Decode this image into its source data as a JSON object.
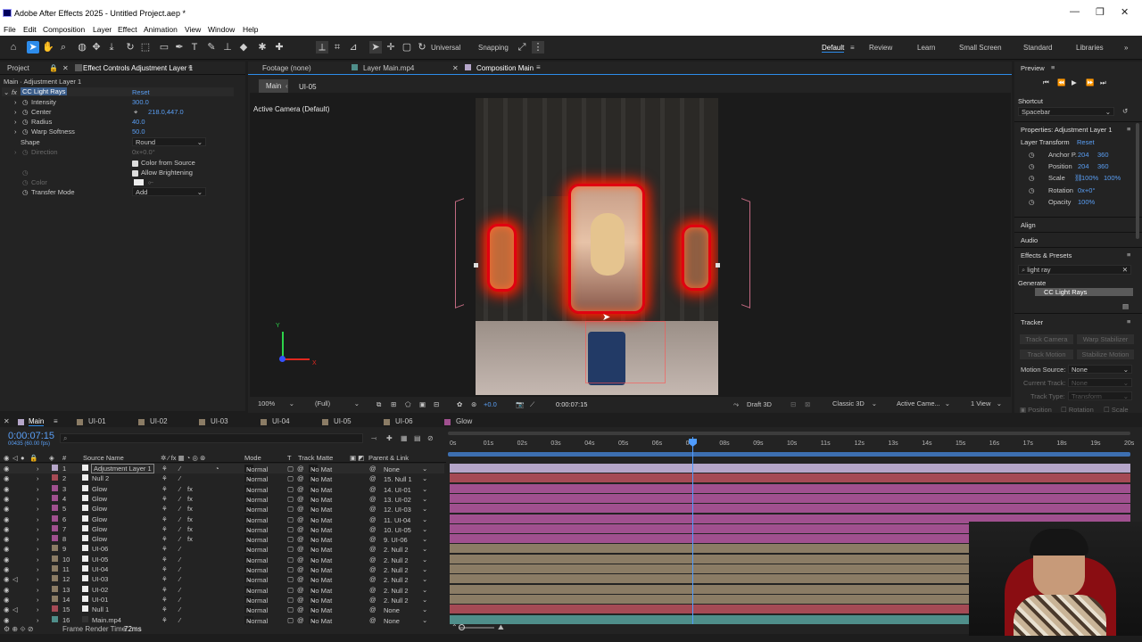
{
  "titlebar": {
    "title": "Adobe After Effects 2025 - Untitled Project.aep *",
    "minimize": "—",
    "maximize": "❐",
    "close": "✕"
  },
  "menu": [
    "File",
    "Edit",
    "Composition",
    "Layer",
    "Effect",
    "Animation",
    "View",
    "Window",
    "Help"
  ],
  "toolbar": {
    "universal": "Universal",
    "snapping": "Snapping"
  },
  "workspaces": [
    "Default",
    "Review",
    "Learn",
    "Small Screen",
    "Standard",
    "Libraries"
  ],
  "left_panel": {
    "tab_project": "Project",
    "tab_effect_controls": "Effect Controls Adjustment Layer 1",
    "layer_path": "Main · Adjustment Layer 1",
    "effect_name": "CC Light Rays",
    "reset": "Reset",
    "props": [
      {
        "label": "Intensity",
        "value": "300.0"
      },
      {
        "label": "Center",
        "value": "218.0,447.0"
      },
      {
        "label": "Radius",
        "value": "40.0"
      },
      {
        "label": "Warp Softness",
        "value": "50.0"
      },
      {
        "label": "Shape",
        "value": "Round"
      },
      {
        "label": "Direction",
        "value": "0x+0.0°"
      },
      {
        "label": "Color from Source",
        "value": ""
      },
      {
        "label": "Allow Brightening",
        "value": ""
      },
      {
        "label": "Color",
        "value": ""
      },
      {
        "label": "Transfer Mode",
        "value": "Add"
      }
    ]
  },
  "viewer": {
    "tabs": [
      "Footage (none)",
      "Layer Main.mp4",
      "Composition Main"
    ],
    "breadcrumb": [
      "Main",
      "UI-05"
    ],
    "camera": "Active Camera (Default)",
    "zoom": "100%",
    "resolution": "(Full)",
    "exposure": "+0.0",
    "timecode": "0:00:07:15",
    "draft": "Draft 3D",
    "renderer": "Classic 3D",
    "camera_dd": "Active Came...",
    "views": "1 View"
  },
  "right_panel": {
    "preview": "Preview",
    "shortcut_label": "Shortcut",
    "shortcut": "Spacebar",
    "properties_title": "Properties: Adjustment Layer 1",
    "layer_transform": "Layer Transform",
    "reset": "Reset",
    "transform": [
      {
        "label": "Anchor P.",
        "v1": "204",
        "v2": "360"
      },
      {
        "label": "Position",
        "v1": "204",
        "v2": "360"
      },
      {
        "label": "Scale",
        "v1": "100%",
        "v2": "100%"
      },
      {
        "label": "Rotation",
        "v1": "0x+0°",
        "v2": ""
      },
      {
        "label": "Opacity",
        "v1": "100%",
        "v2": ""
      }
    ],
    "align": "Align",
    "audio": "Audio",
    "effects_presets": "Effects & Presets",
    "search": "light ray",
    "category": "Generate",
    "effect_item": "CC Light Rays",
    "tracker": "Tracker",
    "track_camera": "Track Camera",
    "warp_stabilizer": "Warp Stabilizer",
    "track_motion": "Track Motion",
    "stabilize_motion": "Stabilize Motion",
    "motion_source_label": "Motion Source:",
    "motion_source": "None",
    "current_track_label": "Current Track:",
    "current_track": "None",
    "track_type_label": "Track Type:",
    "track_type": "Transform",
    "position": "Position",
    "rotation": "Rotation",
    "scale": "Scale"
  },
  "timeline": {
    "tabs": [
      "Main",
      "UI-01",
      "UI-02",
      "UI-03",
      "UI-04",
      "UI-05",
      "UI-06",
      "Glow"
    ],
    "timecode": "0:00:07:15",
    "fps": "00435 (60.00 fps)",
    "headers": {
      "num": "#",
      "source": "Source Name",
      "mode": "Mode",
      "t": "T",
      "matte": "Track Matte",
      "parent": "Parent & Link"
    },
    "ruler": [
      "0s",
      "01s",
      "02s",
      "03s",
      "04s",
      "05s",
      "06s",
      "07s",
      "08s",
      "09s",
      "10s",
      "11s",
      "12s",
      "13s",
      "14s",
      "15s",
      "16s",
      "17s",
      "18s",
      "19s",
      "20s"
    ],
    "layers": [
      {
        "n": "1",
        "name": "Adjustment Layer 1",
        "mode": "Normal",
        "matte": "No Mat",
        "parent": "None",
        "color": "#b5a6c9",
        "end": 1
      },
      {
        "n": "2",
        "name": "Null 2",
        "mode": "Normal",
        "matte": "No Mat",
        "parent": "15. Null 1",
        "color": "#a54a55",
        "end": 1
      },
      {
        "n": "3",
        "name": "Glow",
        "mode": "Normal",
        "matte": "No Mat",
        "parent": "14. UI-01",
        "color": "#a0508f",
        "end": 1
      },
      {
        "n": "4",
        "name": "Glow",
        "mode": "Normal",
        "matte": "No Mat",
        "parent": "13. UI-02",
        "color": "#a0508f",
        "end": 1
      },
      {
        "n": "5",
        "name": "Glow",
        "mode": "Normal",
        "matte": "No Mat",
        "parent": "12. UI-03",
        "color": "#a0508f",
        "end": 1
      },
      {
        "n": "6",
        "name": "Glow",
        "mode": "Normal",
        "matte": "No Mat",
        "parent": "11. UI-04",
        "color": "#a0508f",
        "end": 1
      },
      {
        "n": "7",
        "name": "Glow",
        "mode": "Normal",
        "matte": "No Mat",
        "parent": "10. UI-05",
        "color": "#a0508f",
        "end": 1
      },
      {
        "n": "8",
        "name": "Glow",
        "mode": "Normal",
        "matte": "No Mat",
        "parent": "9. UI-06",
        "color": "#a0508f",
        "end": 1
      },
      {
        "n": "9",
        "name": "UI-06",
        "mode": "Normal",
        "matte": "No Mat",
        "parent": "2. Null 2",
        "color": "#8b7c65",
        "end": 1
      },
      {
        "n": "10",
        "name": "UI-05",
        "mode": "Normal",
        "matte": "No Mat",
        "parent": "2. Null 2",
        "color": "#8b7c65",
        "end": 1
      },
      {
        "n": "11",
        "name": "UI-04",
        "mode": "Normal",
        "matte": "No Mat",
        "parent": "2. Null 2",
        "color": "#8b7c65",
        "end": 1
      },
      {
        "n": "12",
        "name": "UI-03",
        "mode": "Normal",
        "matte": "No Mat",
        "parent": "2. Null 2",
        "color": "#8b7c65",
        "end": 1
      },
      {
        "n": "13",
        "name": "UI-02",
        "mode": "Normal",
        "matte": "No Mat",
        "parent": "2. Null 2",
        "color": "#8b7c65",
        "end": 1
      },
      {
        "n": "14",
        "name": "UI-01",
        "mode": "Normal",
        "matte": "No Mat",
        "parent": "2. Null 2",
        "color": "#8b7c65",
        "end": 1
      },
      {
        "n": "15",
        "name": "Null 1",
        "mode": "Normal",
        "matte": "No Mat",
        "parent": "None",
        "color": "#a54a55",
        "end": 1
      },
      {
        "n": "16",
        "name": "Main.mp4",
        "mode": "Normal",
        "matte": "No Mat",
        "parent": "None",
        "color": "#4f8e8a",
        "end": 1
      }
    ],
    "render_label": "Frame Render Time:",
    "render_time": "72ms"
  }
}
